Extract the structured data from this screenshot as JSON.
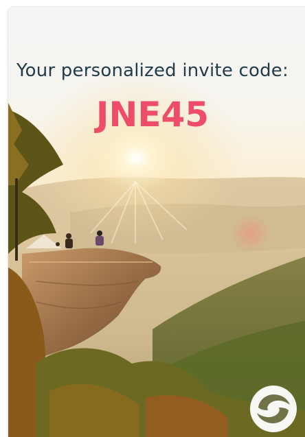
{
  "invite": {
    "headline": "Your personalized invite code:",
    "code": "JNE45"
  },
  "colors": {
    "headline": "#1f3b4a",
    "code": "#ee4d6a"
  },
  "icons": {
    "brand_logo": "swirl-logo-icon"
  }
}
